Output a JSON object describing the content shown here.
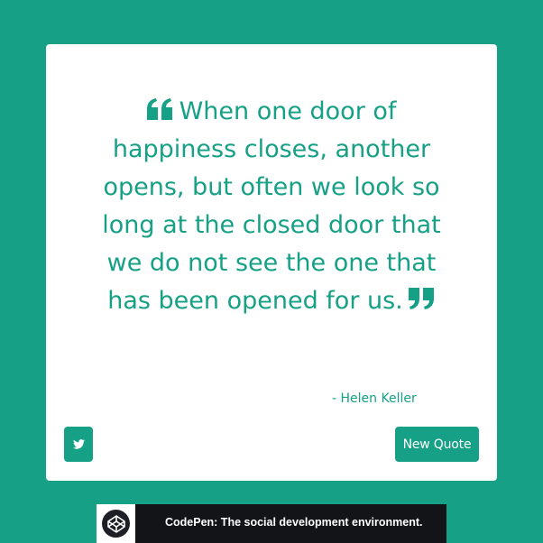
{
  "quote": {
    "text": "When one door of happiness closes, another opens, but often we look so long at the closed door that we do not see the one that has been opened for us.",
    "author": "-  Helen Keller"
  },
  "buttons": {
    "tweet_icon": "twitter-icon",
    "new_quote_label": "New Quote"
  },
  "footer": {
    "logo_icon": "codepen-logo-icon",
    "text": "CodePen: The social development environment."
  },
  "colors": {
    "background": "#16a085",
    "card": "#ffffff",
    "accent": "#16a085",
    "footer_bg": "#131417"
  }
}
